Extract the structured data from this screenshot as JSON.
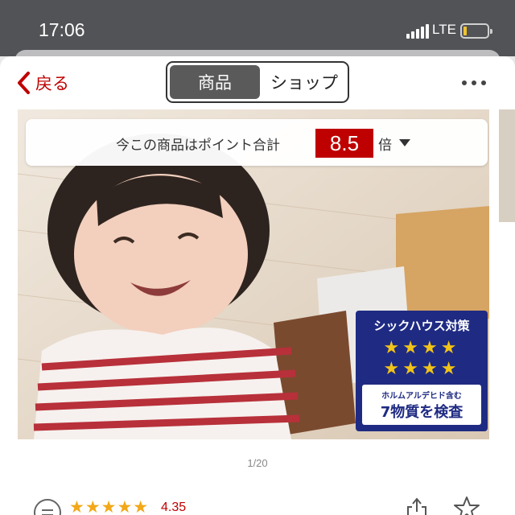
{
  "status_bar": {
    "time": "17:06",
    "network": "LTE",
    "battery_level": 0.15
  },
  "nav": {
    "back_label": "戻る",
    "segments": [
      "商品",
      "ショップ"
    ],
    "selected_segment": "商品"
  },
  "points_banner": {
    "prefix": "今この商品はポイント合計",
    "multiplier": "8.5",
    "suffix": "倍"
  },
  "badge": {
    "title": "シックハウス対策",
    "stars": "★★★★",
    "sub": "ホルムアルデヒド含む",
    "main": "7物質を検査"
  },
  "pager": {
    "indicator": "1/20"
  },
  "rating": {
    "stars": "★★★★★",
    "value": "4.35"
  },
  "colors": {
    "accent": "#bf0000",
    "badge_blue": "#1f2b83",
    "star": "#f2a818"
  },
  "icons": [
    "chevron-left-icon",
    "more-icon",
    "review-icon",
    "share-icon",
    "star-outline-icon"
  ]
}
